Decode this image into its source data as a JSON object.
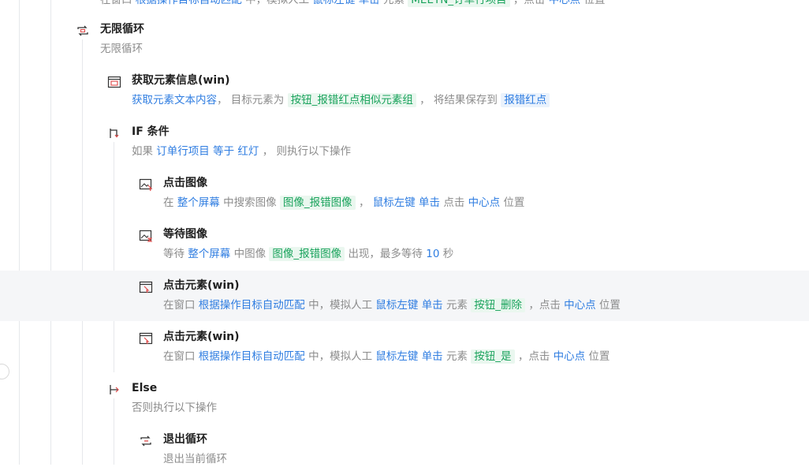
{
  "top_partial": {
    "prefix": "在窗口",
    "window": "根据操作目标自动匹配",
    "mid": "中，模拟人工",
    "mouse": "鼠标左键",
    "click": "单击",
    "elem_word": "元素",
    "element": "MEETN_订单行项目",
    "sep": "，点击",
    "point": "中心点",
    "suffix": "位置"
  },
  "loop": {
    "title": "无限循环",
    "desc": "无限循环"
  },
  "get_info": {
    "title": "获取元素信息(win)",
    "action": "获取元素文本内容",
    "p1": "， 目标元素为",
    "element": "按钮_报错红点相似元素组",
    "p2": "， 将结果保存到",
    "var": "报错红点"
  },
  "if": {
    "title": "IF 条件",
    "p1": "如果",
    "var": "订单行项目",
    "op": "等于",
    "value": "红灯",
    "p2": "， 则执行以下操作"
  },
  "click_image": {
    "title": "点击图像",
    "p1": "在",
    "scope": "整个屏幕",
    "p2": "中搜索图像",
    "image": "图像_报错图像",
    "p3": "，",
    "mouse": "鼠标左键",
    "click": "单击",
    "p4": "点击",
    "point": "中心点",
    "p5": "位置"
  },
  "wait_image": {
    "title": "等待图像",
    "p1": "等待",
    "scope": "整个屏幕",
    "p2": "中图像",
    "image": "图像_报错图像",
    "p3": "出现，最多等待",
    "seconds": "10",
    "p4": "秒"
  },
  "click_delete": {
    "title": "点击元素(win)",
    "p1": "在窗口",
    "window": "根据操作目标自动匹配",
    "p2": "中，模拟人工",
    "mouse": "鼠标左键",
    "click": "单击",
    "p3": "元素",
    "element": "按钮_删除",
    "p4": "，点击",
    "point": "中心点",
    "p5": "位置"
  },
  "click_yes": {
    "title": "点击元素(win)",
    "p1": "在窗口",
    "window": "根据操作目标自动匹配",
    "p2": "中，模拟人工",
    "mouse": "鼠标左键",
    "click": "单击",
    "p3": "元素",
    "element": "按钮_是",
    "p4": "，点击",
    "point": "中心点",
    "p5": "位置"
  },
  "else": {
    "title": "Else",
    "desc": "否则执行以下操作"
  },
  "exit_loop": {
    "title": "退出循环",
    "desc": "退出当前循环"
  }
}
